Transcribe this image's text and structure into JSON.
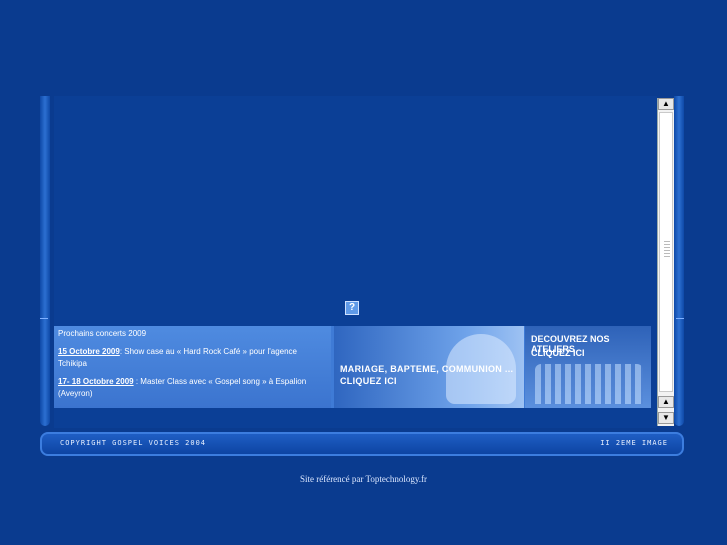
{
  "help_icon_glyph": "?",
  "concerts": {
    "heading": "Prochains concerts 2009",
    "item1_date": "15 Octobre 2009",
    "item1_text": ": Show case au « Hard Rock Café » pour l'agence Tchikipa",
    "item2_date": "17- 18 Octobre 2009",
    "item2_text": " : Master Class avec « Gospel song » à Espalion (Aveyron)"
  },
  "banner_mariage": {
    "line1": "MARIAGE, BAPTEME, COMMUNION ...",
    "line2": "CLIQUEZ ICI"
  },
  "banner_ateliers": {
    "line1": "DECOUVREZ NOS ATELIERS",
    "line2": "CLIQUEZ ICI"
  },
  "scrollbar": {
    "up_glyph": "▲",
    "down_glyph": "▼"
  },
  "footer": {
    "copyright": "COPYRIGHT GOSPEL VOICES 2004",
    "second_image": "II 2EME IMAGE"
  },
  "referer": "Site référencé par Toptechnology.fr",
  "colors": {
    "background": "#0a3b8f",
    "strip": "#3f7bd6",
    "footer": "#1f5ec4"
  }
}
